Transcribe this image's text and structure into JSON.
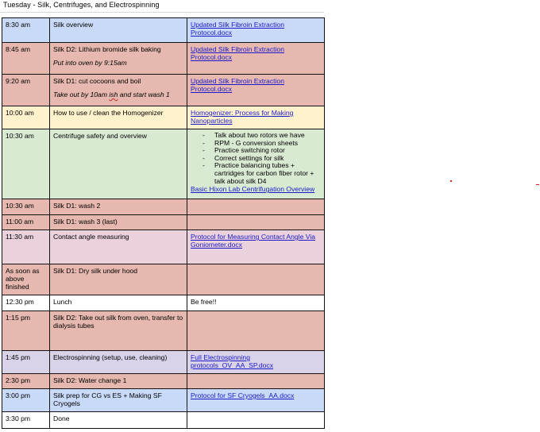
{
  "title": "Tuesday - Silk, Centrifuges, and Electrospinning",
  "colors": {
    "blue": "#c9daf8",
    "red": "#e6b8af",
    "yellow": "#fff2cc",
    "green": "#d9ead3",
    "purple": "#ead1dc",
    "lavender": "#d9d2e9",
    "white": "#ffffff",
    "link": "#1b1bc9"
  },
  "rows": [
    {
      "time": "8:30 am",
      "activity": "Silk overview",
      "link": "Updated Silk Fibroin Extraction Protocol.docx"
    },
    {
      "time": "8:45 am",
      "activity": "Silk D2: Lithium bromide silk baking",
      "note": "Put into oven by 9:15am",
      "link": "Updated Silk Fibroin Extraction Protocol.docx"
    },
    {
      "time": "9:20 am",
      "activity": "Silk D1: cut cocoons and boil",
      "note_a": "Take out by 10am ",
      "note_b": "ish",
      "note_c": " and start wash 1",
      "link": "Updated Silk Fibroin Extraction Protocol.docx"
    },
    {
      "time": "10:00 am",
      "activity": "How to use / clean the Homogenizer",
      "link": "Homogenizer: Process for Making Nanoparticles"
    },
    {
      "time": "10:30 am",
      "activity": "Centrifuge safety and overview",
      "bullets": [
        "Talk about two rotors we have",
        "RPM - G conversion sheets",
        "Practice switching rotor",
        "Correct settings for silk",
        "Practice balancing tubes + cartridges for carbon fiber rotor + talk about silk D4"
      ],
      "link": "Basic Hixon Lab Centrifugation Overview"
    },
    {
      "time": "10:30 am",
      "activity": "Silk D1: wash 2"
    },
    {
      "time": "11:00 am",
      "activity": "Silk D1: wash 3 (last)"
    },
    {
      "time": "11:30 am",
      "activity": "Contact angle measuring",
      "link": "Protocol for Measuring Contact Angle Via Goniometer.docx"
    },
    {
      "time": "As soon as above finished",
      "activity": "Silk D1: Dry silk under hood"
    },
    {
      "time": "12:30 pm",
      "activity": "Lunch",
      "text": "Be free!!"
    },
    {
      "time": "1:15 pm",
      "activity": "Silk D2: Take out silk from oven, transfer to dialysis tubes"
    },
    {
      "time": "1:45 pm",
      "activity": "Electrospinning (setup, use, cleaning)",
      "link": "Full Electrospinning protocols_OV_AA_SP.docx"
    },
    {
      "time": "2:30 pm",
      "activity": "Silk D2: Water change 1"
    },
    {
      "time": "3:00 pm",
      "activity": "Silk prep for CG vs ES + Making SF Cryogels",
      "link": "Protocol for SF Cryogels_AA.docx"
    },
    {
      "time": "3:30 pm",
      "activity": "Done"
    }
  ]
}
